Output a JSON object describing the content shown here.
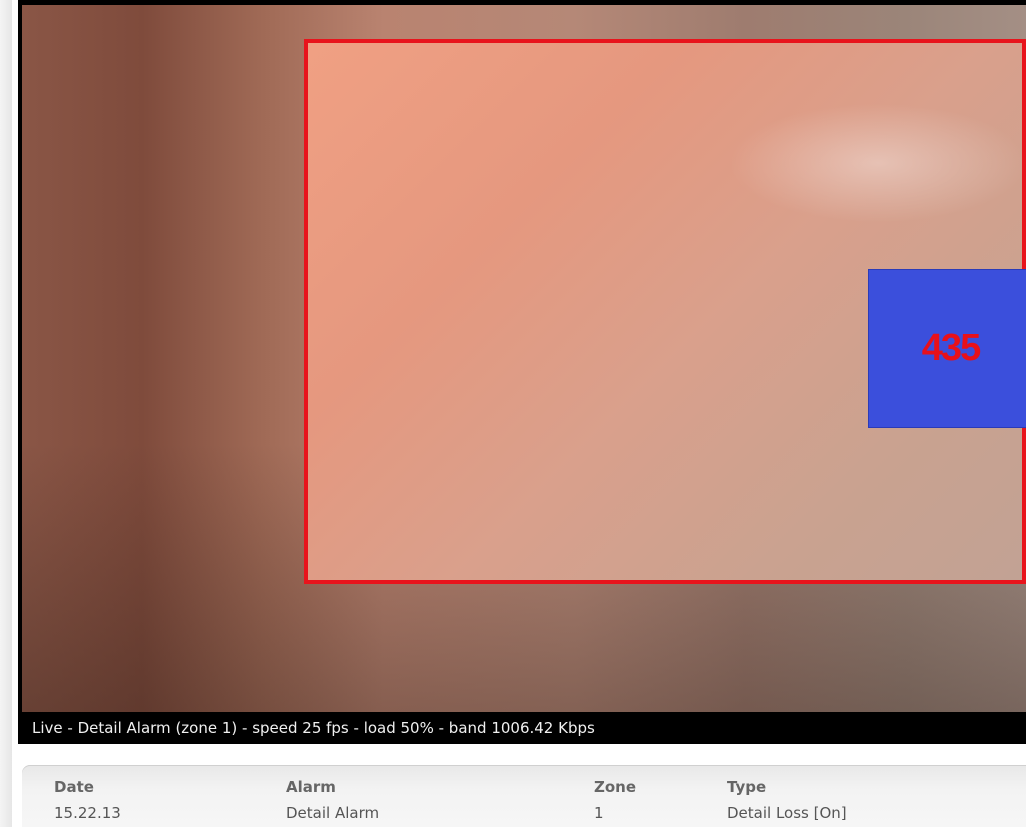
{
  "video": {
    "alarm_value": "435",
    "zone_border_color": "#e8141c",
    "marker_color": "#3b4fdc"
  },
  "status_bar": {
    "text": "Live - Detail Alarm (zone 1) - speed 25 fps - load 50% - band 1006.42 Kbps"
  },
  "alarm_table": {
    "headers": {
      "date": "Date",
      "alarm": "Alarm",
      "zone": "Zone",
      "type": "Type"
    },
    "rows": [
      {
        "date": "15.22.13",
        "alarm": "Detail Alarm",
        "zone": "1",
        "type": "Detail Loss [On]"
      }
    ]
  }
}
